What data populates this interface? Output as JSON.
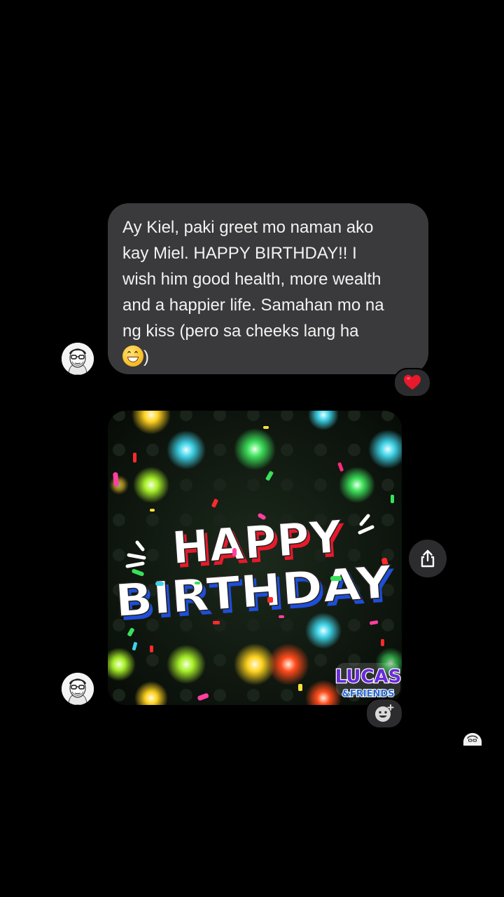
{
  "conversation": {
    "messages": [
      {
        "type": "text",
        "lines": [
          "Ay Kiel, paki greet mo naman ako",
          "kay Miel. HAPPY BIRTHDAY!! I",
          "wish him good health, more wealth",
          "and a happier life. Samahan mo na",
          "ng kiss (pero sa cheeks lang ha",
          ")"
        ],
        "reaction": "heart-icon"
      },
      {
        "type": "gif",
        "title_line1": "HAPPY",
        "title_line2": "BIRTHDAY",
        "brand_line1": "LUCAS",
        "brand_line2": "&FRIENDS",
        "actions": [
          "share-icon",
          "add-reaction-icon"
        ]
      }
    ]
  },
  "colors": {
    "background": "#000000",
    "bubble": "#3a3a3c",
    "text": "#f2f2f2",
    "heart": "#e8192c"
  }
}
